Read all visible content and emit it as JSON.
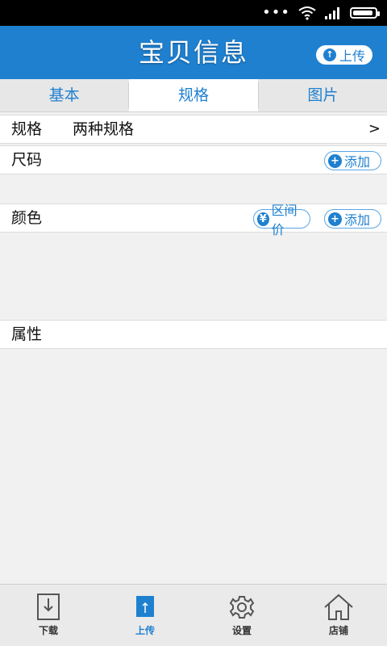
{
  "header": {
    "title": "宝贝信息",
    "upload_label": "上传"
  },
  "tabs": [
    {
      "label": "基本",
      "active": false
    },
    {
      "label": "规格",
      "active": true
    },
    {
      "label": "图片",
      "active": false
    }
  ],
  "spec": {
    "label": "规格",
    "value": "两种规格",
    "arrow": ">"
  },
  "size": {
    "label": "尺码",
    "add_label": "添加"
  },
  "color": {
    "label": "颜色",
    "range_price_label": "区间价",
    "add_label": "添加"
  },
  "attributes": {
    "label": "属性"
  },
  "bottom_nav": [
    {
      "label": "下载",
      "icon": "download-icon"
    },
    {
      "label": "上传",
      "icon": "upload-icon",
      "active": true
    },
    {
      "label": "设置",
      "icon": "gear-icon"
    },
    {
      "label": "店铺",
      "icon": "home-icon"
    }
  ],
  "colors": {
    "accent": "#1f80d0",
    "background": "#f1f1f1"
  }
}
